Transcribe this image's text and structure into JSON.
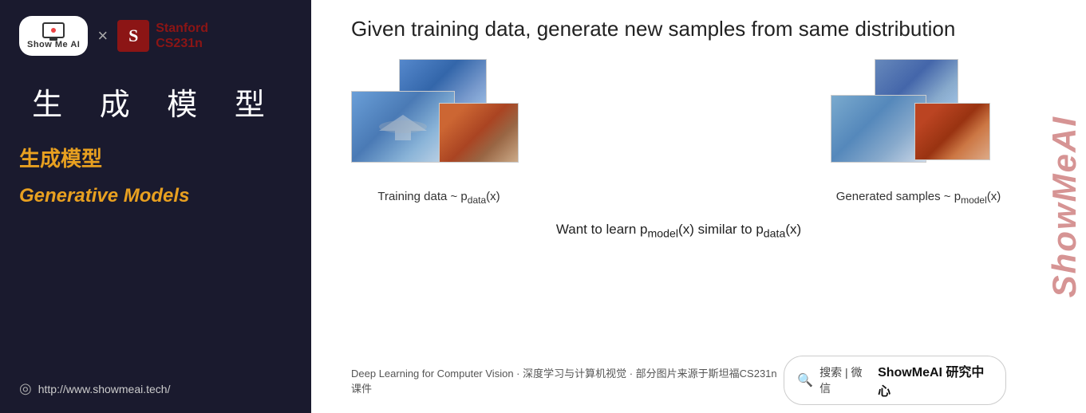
{
  "sidebar": {
    "showmeai_text": "Show Me AI",
    "times": "×",
    "stanford_initial": "S",
    "stanford_name": "Stanford",
    "stanford_course": "CS231n",
    "chinese_title": "生 成 模 型",
    "chinese_subtitle": "生成模型",
    "english_subtitle": "Generative Models",
    "website_url": "http://www.showmeai.tech/"
  },
  "main": {
    "title": "Given training data, generate new samples from same distribution",
    "left_caption": "Training data ~ p",
    "left_caption_sub": "data",
    "left_caption_end": "(x)",
    "right_caption": "Generated samples ~ p",
    "right_caption_sub": "model",
    "right_caption_end": "(x)",
    "bottom_text_1": "Want to learn p",
    "bottom_sub_1": "model",
    "bottom_text_2": "(x) similar to p",
    "bottom_sub_2": "data",
    "bottom_text_3": "(x)"
  },
  "footer": {
    "left_text": "Deep Learning for Computer Vision · 深度学习与计算机视觉 · 部分图片来源于斯坦福CS231n课件",
    "search_label": "搜索 | 微信",
    "search_brand": "ShowMeAI 研究中心"
  },
  "watermark": {
    "text": "ShowMeAI"
  }
}
